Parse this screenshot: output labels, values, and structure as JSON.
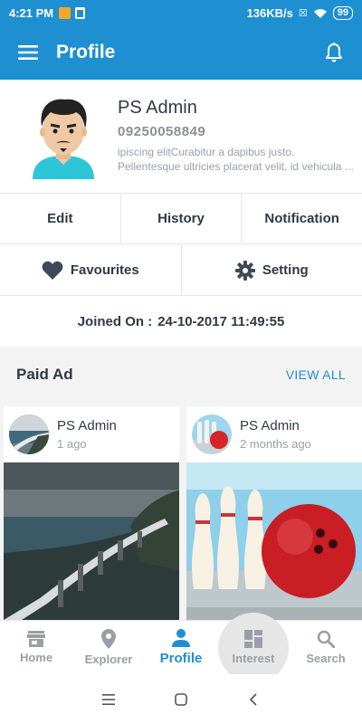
{
  "status_bar": {
    "time": "4:21 PM",
    "network_speed": "136KB/s",
    "battery": "99"
  },
  "app_bar": {
    "title": "Profile"
  },
  "profile": {
    "name": "PS Admin",
    "phone": "09250058849",
    "bio_line1": "ipiscing elitCurabitur a dapibus justo.",
    "bio_line2": "Pellentesque ultricies placerat velit, id vehicula ..."
  },
  "actions": {
    "edit": "Edit",
    "history": "History",
    "notification": "Notification",
    "favourites": "Favourites",
    "setting": "Setting"
  },
  "joined": {
    "label": "Joined On :",
    "value": "24-10-2017 11:49:55"
  },
  "paid_ad": {
    "title": "Paid Ad",
    "view_all": "VIEW ALL",
    "cards": [
      {
        "author": "PS Admin",
        "time": "1 ago"
      },
      {
        "author": "PS Admin",
        "time": "2 months ago"
      }
    ]
  },
  "bottom_nav": {
    "home": "Home",
    "explorer": "Explorer",
    "profile": "Profile",
    "interest": "Interest",
    "search": "Search"
  },
  "colors": {
    "primary": "#1e8fd1",
    "text": "#2f3a45",
    "muted": "#9a9fa6"
  }
}
